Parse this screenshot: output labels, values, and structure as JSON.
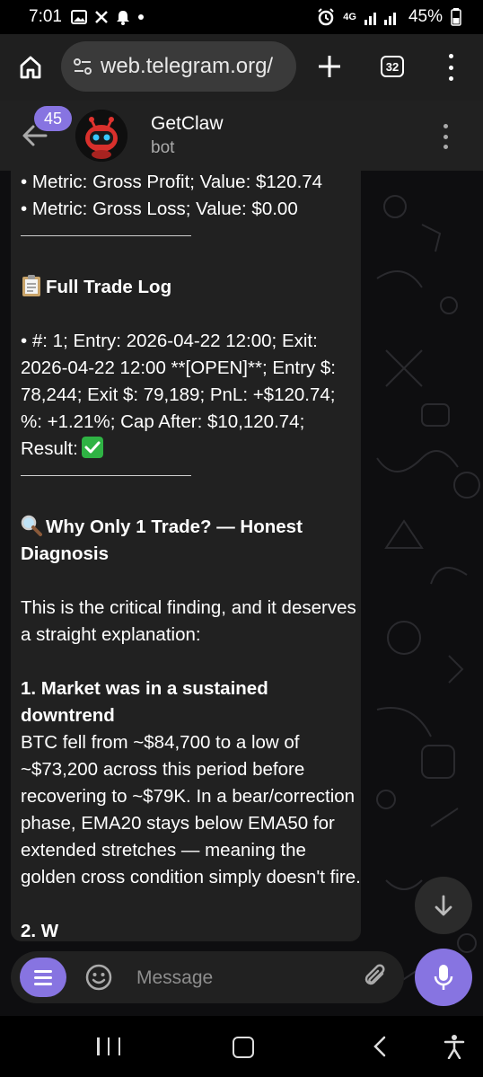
{
  "status_bar": {
    "time": "7:01",
    "network": "4G",
    "battery": "45%"
  },
  "browser": {
    "url": "web.telegram.org/",
    "tab_count": "32"
  },
  "chat": {
    "unread_count": "45",
    "name": "GetClaw",
    "status": "bot"
  },
  "message": {
    "metric_gross_profit": "• Metric: Gross Profit; Value: $120.74",
    "metric_gross_loss": "• Metric: Gross Loss; Value: $0.00",
    "trade_log_heading": "Full Trade Log",
    "trade_log_entry": "• #: 1; Entry: 2026-04-22 12:00; Exit: 2026-04-22 12:00 **[OPEN]**; Entry $: 78,244; Exit $: 79,189; PnL: +$120.74; %: +1.21%; Cap After: $10,120.74; Result:",
    "why_heading": "Why Only 1 Trade? — Honest Diagnosis",
    "intro": "This is the critical finding, and it deserves a straight explanation:",
    "point1_heading": "1. Market was in a sustained downtrend",
    "point1_body": "BTC fell from ~$84,700 to a low of ~$73,200 across this period before recovering to ~$79K. In a bear/correction phase, EMA20 stays below EMA50 for extended stretches — meaning the golden cross condition simply doesn't fire.",
    "point2_partial": "2. W"
  },
  "composer": {
    "placeholder": "Message"
  },
  "colors": {
    "accent": "#8774e1",
    "header_bg": "#212121",
    "chat_bg": "#0e0e10",
    "bubble_bg": "#212121",
    "success_green": "#2fb344"
  },
  "icons": {
    "status": [
      "image-icon",
      "x-icon",
      "notification-bell-icon",
      "dot-icon",
      "alarm-icon",
      "signal-icon",
      "battery-icon"
    ],
    "trade_log": "clipboard-icon",
    "why": "magnifier-icon",
    "result": "check-mark-icon"
  }
}
